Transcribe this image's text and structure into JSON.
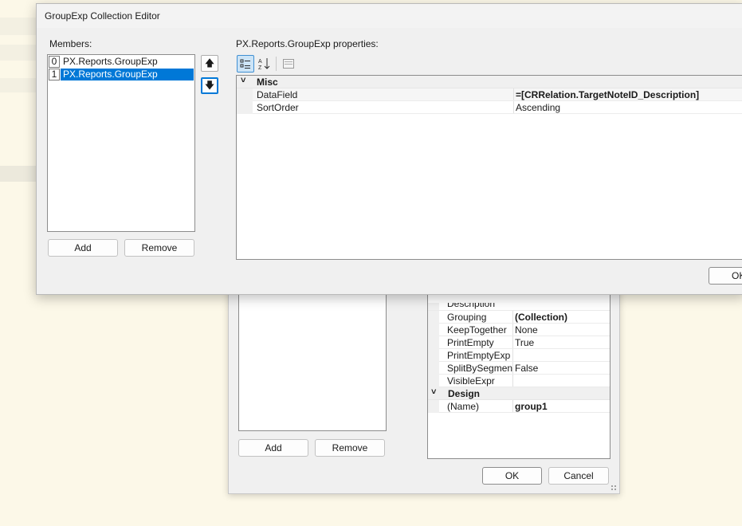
{
  "background_dialog": {
    "properties": [
      {
        "name": "Description",
        "value": "",
        "bold": false,
        "type": "row"
      },
      {
        "name": "Grouping",
        "value": "(Collection)",
        "bold": true,
        "type": "row"
      },
      {
        "name": "KeepTogether",
        "value": "None",
        "bold": false,
        "type": "row"
      },
      {
        "name": "PrintEmpty",
        "value": "True",
        "bold": false,
        "type": "row"
      },
      {
        "name": "PrintEmptyExp",
        "value": "",
        "bold": false,
        "type": "row"
      },
      {
        "name": "SplitBySegments",
        "value": "False",
        "bold": false,
        "type": "row"
      },
      {
        "name": "VisibleExpr",
        "value": "",
        "bold": false,
        "type": "row"
      }
    ],
    "design_category": "Design",
    "design_rows": [
      {
        "name": "(Name)",
        "value": "group1",
        "bold": true
      }
    ],
    "add_label": "Add",
    "remove_label": "Remove",
    "ok_label": "OK",
    "cancel_label": "Cancel"
  },
  "front_dialog": {
    "title": "GroupExp Collection Editor",
    "members_label": "Members:",
    "properties_label": "PX.Reports.GroupExp properties:",
    "members": [
      {
        "index": "0",
        "name": "PX.Reports.GroupExp",
        "selected": false
      },
      {
        "index": "1",
        "name": "PX.Reports.GroupExp",
        "selected": true
      }
    ],
    "move_up_glyph": "🡅",
    "move_down_glyph": "🡇",
    "add_label": "Add",
    "remove_label": "Remove",
    "ok_label": "OK",
    "category": "Misc",
    "properties": [
      {
        "name": "DataField",
        "value": "=[CRRelation.TargetNoteID_Description]",
        "bold": true
      },
      {
        "name": "SortOrder",
        "value": "Ascending",
        "bold": false
      }
    ],
    "toolbar": {
      "categorized_icon": "categorized-icon",
      "alphabetical_icon": "alphabetical-icon",
      "property_pages_icon": "property-pages-icon"
    }
  },
  "colors": {
    "selection": "#0078d7",
    "background": "#fcf8e8",
    "dialog": "#f0f0f0"
  }
}
